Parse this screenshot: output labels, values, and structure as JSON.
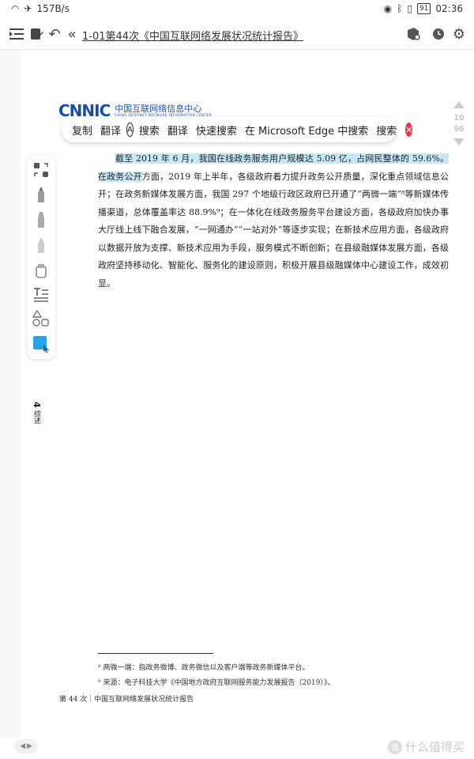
{
  "status_bar": {
    "network_speed": "157B/s",
    "battery": "91",
    "time": "02:36"
  },
  "toolbar": {
    "title": "1-01第44次《中国互联网络发展状况统计报告》"
  },
  "logo": {
    "mark": "CNNIC",
    "cn_name": "中国互联网络信息中心",
    "en_name": "CHINA INTERNET NETWORK INFORMATION CENTER"
  },
  "context_menu": {
    "items": [
      "复制",
      "翻译",
      "A",
      "搜索",
      "翻译",
      "快速搜索",
      "在 Microsoft Edge 中搜索",
      "搜索"
    ]
  },
  "scroller": {
    "current_page": "10",
    "total_pages": "96"
  },
  "body": {
    "selected": "截至 2019 年 6 月，我国在线政务服务用户规模达 5.09 亿，占网民整体的 59.6%。在政务",
    "line2_selected": "公开",
    "rest": "方面，2019 年上半年，各级政府着力提升政务公开质量，深化重点领域信息公开；在政务新媒体发展方面，我国 297 个地级行政区政府已开通了“两微一端”⁸等新媒体传播渠道，总体覆盖率达 88.9%⁹；在一体化在线政务服务平台建设方面，各级政府加快办事大厅线上线下融合发展，“一网通办”“一站对外”等逐步实现；在新技术应用方面，各级政府以数据开放为支撑、新技术应用为手段，服务模式不断创新；在县级融媒体发展方面，各级政府坚持移动化、智能化、服务化的建设原则，积极开展县级融媒体中心建设工作，成效初显。"
  },
  "side_label": {
    "number": "4",
    "text": "综述"
  },
  "footnotes": [
    "⁸ 两微一端：指政务微博、政务微信以及客户端等政务新媒体平台。",
    "⁹ 来源：电子科技大学《中国地方政府互联网服务能力发展报告（2019）》。"
  ],
  "page_footer": "第 44 次｜中国互联网络发展状况统计报告",
  "watermark": "什么值得买",
  "colors": {
    "highlight": "#c7e8f7",
    "logo": "#1a4f9c",
    "close": "#e23b4a"
  }
}
